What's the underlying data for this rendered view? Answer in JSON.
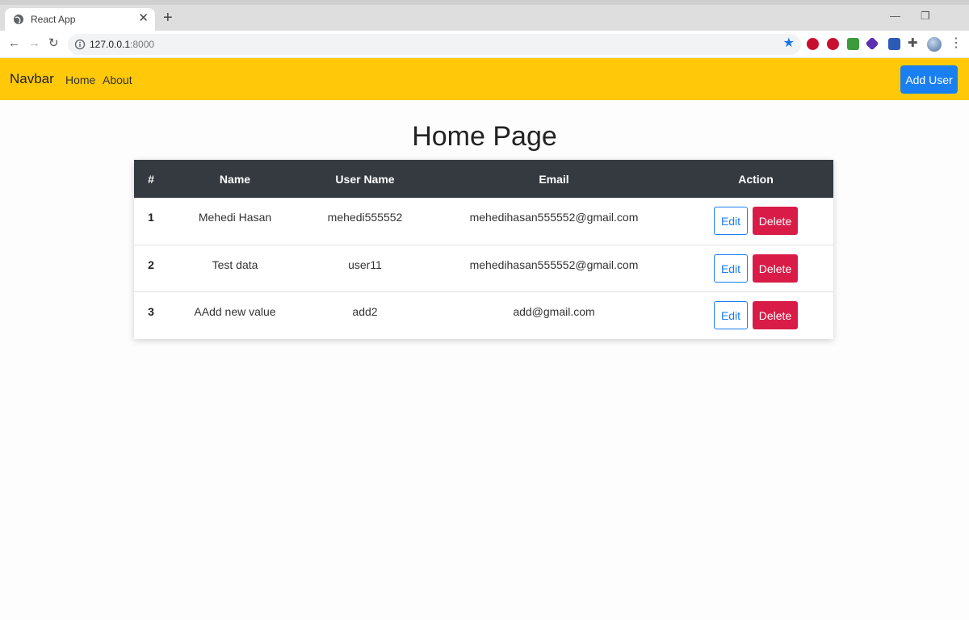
{
  "browser": {
    "tab_title": "React App",
    "tab_close": "✕",
    "new_tab": "+",
    "window_controls": {
      "minimize": "—",
      "restore": "❐"
    },
    "nav": {
      "back": "←",
      "forward": "→",
      "reload": "↻"
    },
    "url_host": "127.0.0.1",
    "url_port": ":8000",
    "bookmark_icon": "★",
    "extensions_icon": "✚",
    "menu_icon": "⋮"
  },
  "navbar": {
    "brand": "Navbar",
    "links": [
      "Home",
      "About"
    ],
    "add_user_label": "Add User",
    "background": "#ffc90a"
  },
  "page": {
    "title": "Home Page"
  },
  "table": {
    "headers": [
      "#",
      "Name",
      "User Name",
      "Email",
      "Action"
    ],
    "rows": [
      {
        "num": "1",
        "name": "Mehedi Hasan",
        "username": "mehedi555552",
        "email": "mehedihasan555552@gmail.com"
      },
      {
        "num": "2",
        "name": "Test data",
        "username": "user11",
        "email": "mehedihasan555552@gmail.com"
      },
      {
        "num": "3",
        "name": "AAdd new value",
        "username": "add2",
        "email": "add@gmail.com"
      }
    ],
    "edit_label": "Edit",
    "delete_label": "Delete",
    "header_bg": "#343a40",
    "edit_color": "#1a7ff0",
    "delete_color": "#d81c47"
  }
}
